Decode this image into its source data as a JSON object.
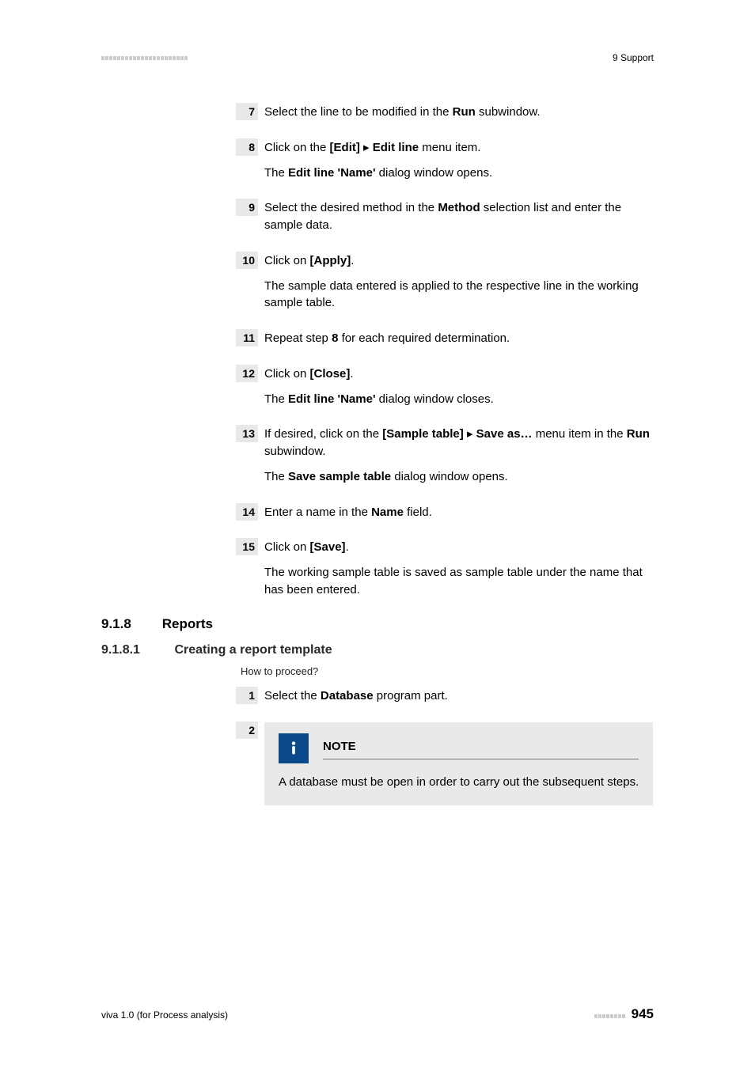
{
  "header": {
    "right": "9 Support"
  },
  "steps_a": [
    {
      "num": "7",
      "lines": [
        [
          {
            "t": "Select the line to be modified in the "
          },
          {
            "t": "Run",
            "b": true
          },
          {
            "t": " subwindow."
          }
        ]
      ]
    },
    {
      "num": "8",
      "lines": [
        [
          {
            "t": "Click on the "
          },
          {
            "t": "[Edit]",
            "b": true
          },
          {
            "t": " ▸ "
          },
          {
            "t": "Edit line",
            "b": true
          },
          {
            "t": " menu item."
          }
        ],
        [
          {
            "t": "The "
          },
          {
            "t": "Edit line 'Name'",
            "b": true
          },
          {
            "t": " dialog window opens."
          }
        ]
      ]
    },
    {
      "num": "9",
      "lines": [
        [
          {
            "t": "Select the desired method in the "
          },
          {
            "t": "Method",
            "b": true
          },
          {
            "t": " selection list and enter the sample data."
          }
        ]
      ]
    },
    {
      "num": "10",
      "lines": [
        [
          {
            "t": "Click on "
          },
          {
            "t": "[Apply]",
            "b": true
          },
          {
            "t": "."
          }
        ],
        [
          {
            "t": "The sample data entered is applied to the respective line in the working sample table."
          }
        ]
      ]
    },
    {
      "num": "11",
      "lines": [
        [
          {
            "t": "Repeat step "
          },
          {
            "t": "8",
            "b": true
          },
          {
            "t": " for each required determination."
          }
        ]
      ]
    },
    {
      "num": "12",
      "lines": [
        [
          {
            "t": "Click on "
          },
          {
            "t": "[Close]",
            "b": true
          },
          {
            "t": "."
          }
        ],
        [
          {
            "t": "The "
          },
          {
            "t": "Edit line 'Name'",
            "b": true
          },
          {
            "t": " dialog window closes."
          }
        ]
      ]
    },
    {
      "num": "13",
      "lines": [
        [
          {
            "t": "If desired, click on the "
          },
          {
            "t": "[Sample table]",
            "b": true
          },
          {
            "t": " ▸ "
          },
          {
            "t": "Save as…",
            "b": true
          },
          {
            "t": " menu item in the "
          },
          {
            "t": "Run",
            "b": true
          },
          {
            "t": " subwindow."
          }
        ],
        [
          {
            "t": "The "
          },
          {
            "t": "Save sample table",
            "b": true
          },
          {
            "t": " dialog window opens."
          }
        ]
      ]
    },
    {
      "num": "14",
      "lines": [
        [
          {
            "t": "Enter a name in the "
          },
          {
            "t": "Name",
            "b": true
          },
          {
            "t": " field."
          }
        ]
      ]
    },
    {
      "num": "15",
      "lines": [
        [
          {
            "t": "Click on "
          },
          {
            "t": "[Save]",
            "b": true
          },
          {
            "t": "."
          }
        ],
        [
          {
            "t": "The working sample table is saved as sample table under the name that has been entered."
          }
        ]
      ]
    }
  ],
  "sec918": {
    "num": "9.1.8",
    "title": "Reports"
  },
  "sec9181": {
    "num": "9.1.8.1",
    "title": "Creating a report template"
  },
  "how": "How to proceed?",
  "steps_b": [
    {
      "num": "1",
      "lines": [
        [
          {
            "t": "Select the "
          },
          {
            "t": "Database",
            "b": true
          },
          {
            "t": " program part."
          }
        ]
      ]
    }
  ],
  "step2_num": "2",
  "note": {
    "title": "NOTE",
    "body": "A database must be open in order to carry out the subsequent steps."
  },
  "footer": {
    "left": "viva 1.0 (for Process analysis)",
    "page": "945"
  }
}
